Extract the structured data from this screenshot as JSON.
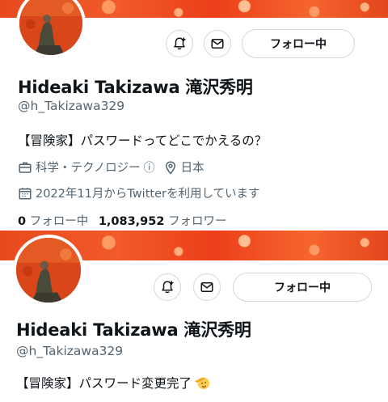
{
  "profile_top": {
    "display_name": "Hideaki Takizawa 滝沢秀明",
    "handle": "@h_Takizawa329",
    "bio": "【冒険家】パスワードってどこでかえるの？",
    "category": "科学・テクノロジー",
    "info_glyph": "ⓘ",
    "location": "日本",
    "joined": "2022年11月からTwitterを利用しています",
    "following_count": "0",
    "following_label": "フォロー中",
    "followers_count": "1,083,952",
    "followers_label": "フォロワー",
    "follow_button_label": "フォロー中"
  },
  "profile_bottom": {
    "display_name": "Hideaki Takizawa 滝沢秀明",
    "handle": "@h_Takizawa329",
    "bio": "【冒険家】パスワード変更完了",
    "bio_emoji_icon": "salute-face-icon",
    "follow_button_label": "フォロー中"
  },
  "icons": [
    "bell-plus-icon",
    "mail-icon",
    "briefcase-icon",
    "location-pin-icon",
    "calendar-icon"
  ],
  "colors": {
    "banner_orange": "#ec4a1e",
    "border": "#cfd9de",
    "secondary_text": "#536471"
  }
}
